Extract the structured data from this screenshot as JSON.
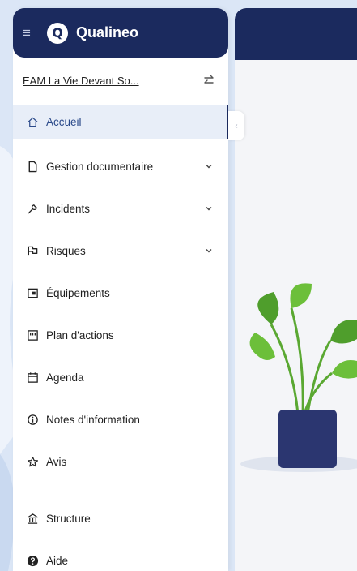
{
  "app": {
    "brand": "Qualineo",
    "logo_letter": "Q"
  },
  "organization": {
    "name": "EAM La Vie Devant So..."
  },
  "sidebar": {
    "items": [
      {
        "label": "Accueil",
        "icon": "home-icon",
        "active": true,
        "expandable": false
      },
      {
        "label": "Gestion documentaire",
        "icon": "document-icon",
        "active": false,
        "expandable": true
      },
      {
        "label": "Incidents",
        "icon": "wrench-icon",
        "active": false,
        "expandable": true
      },
      {
        "label": "Risques",
        "icon": "flag-icon",
        "active": false,
        "expandable": true
      },
      {
        "label": "Équipements",
        "icon": "equipment-icon",
        "active": false,
        "expandable": false
      },
      {
        "label": "Plan d'actions",
        "icon": "action-plan-icon",
        "active": false,
        "expandable": false
      },
      {
        "label": "Agenda",
        "icon": "calendar-icon",
        "active": false,
        "expandable": false
      },
      {
        "label": "Notes d'information",
        "icon": "info-icon",
        "active": false,
        "expandable": false
      },
      {
        "label": "Avis",
        "icon": "star-icon",
        "active": false,
        "expandable": false
      },
      {
        "label": "Structure",
        "icon": "building-icon",
        "active": false,
        "expandable": false
      },
      {
        "label": "Aide",
        "icon": "help-icon",
        "active": false,
        "expandable": false
      }
    ]
  },
  "colors": {
    "primary": "#1b2a5e",
    "active_bg": "#e8eef8",
    "active_text": "#2b4a8a",
    "background": "#dbe6f6",
    "plant_green": "#5aa832",
    "pot": "#2b3670"
  }
}
